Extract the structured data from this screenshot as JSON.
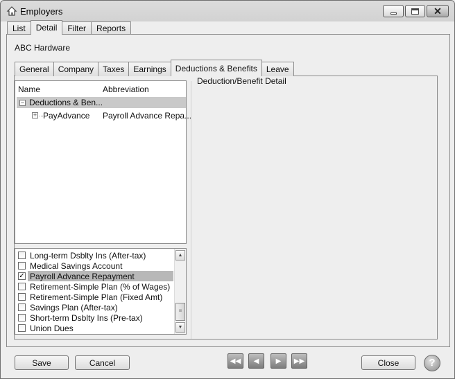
{
  "window": {
    "title": "Employers"
  },
  "top_tabs": [
    "List",
    "Detail",
    "Filter",
    "Reports"
  ],
  "employer_name": "ABC Hardware",
  "sub_tabs": [
    "General",
    "Company",
    "Taxes",
    "Earnings",
    "Deductions & Benefits",
    "Leave"
  ],
  "tree": {
    "col_name": "Name",
    "col_abbreviation": "Abbreviation",
    "group_label": "Deductions & Ben...",
    "child_name": "PayAdvance",
    "child_abbreviation": "Payroll Advance Repa..."
  },
  "checklist": [
    {
      "label": "Long-term Dsblty Ins (After-tax)",
      "checked": false,
      "selected": false
    },
    {
      "label": "Medical Savings Account",
      "checked": false,
      "selected": false
    },
    {
      "label": "Payroll Advance Repayment",
      "checked": true,
      "selected": true
    },
    {
      "label": "Retirement-Simple Plan (% of Wages)",
      "checked": false,
      "selected": false
    },
    {
      "label": "Retirement-Simple Plan (Fixed Amt)",
      "checked": false,
      "selected": false
    },
    {
      "label": "Savings Plan (After-tax)",
      "checked": false,
      "selected": false
    },
    {
      "label": "Short-term Dsblty Ins (Pre-tax)",
      "checked": false,
      "selected": false
    },
    {
      "label": "Union Dues",
      "checked": false,
      "selected": false
    }
  ],
  "detail": {
    "title": "Deduction/Benefit Detail"
  },
  "buttons": {
    "save": "Save",
    "cancel": "Cancel",
    "close": "Close",
    "first_glyph": "◀◀",
    "prev_glyph": "◀",
    "next_glyph": "▶",
    "last_glyph": "▶▶",
    "help_glyph": "?"
  },
  "window_buttons": {
    "close_glyph": "✕"
  },
  "tree_glyphs": {
    "collapse": "−",
    "expand": "+"
  },
  "scroll_glyphs": {
    "up": "▲",
    "down": "▼",
    "grip": "≡"
  },
  "check_glyph": "✓"
}
